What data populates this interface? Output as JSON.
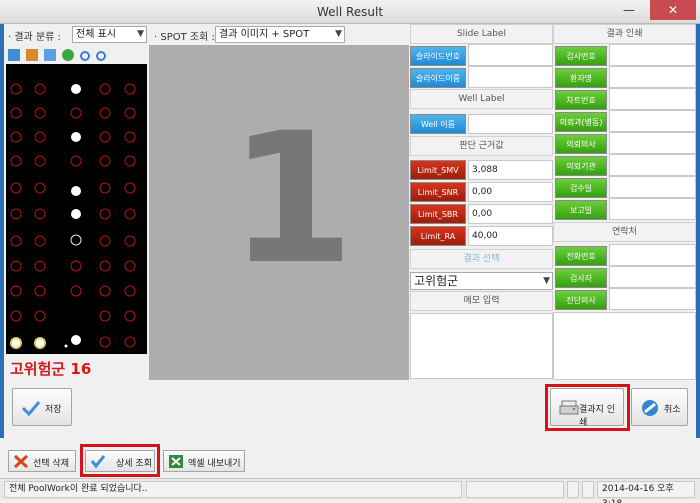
{
  "window": {
    "title": "Well Result",
    "minimize": "—",
    "close": "✕"
  },
  "filters": {
    "result_class_label": "· 결과 분류 :",
    "result_class_value": "전체 표시",
    "spot_label": "· SPOT 조회 :",
    "spot_value": "결과 이미지 + SPOT"
  },
  "view": {
    "well_number": "1",
    "result_name": "고위험군 16"
  },
  "slide_label": {
    "header": "Slide Label",
    "items": [
      {
        "label": "슬라이드번호",
        "value": ""
      },
      {
        "label": "슬라이드이름",
        "value": ""
      }
    ]
  },
  "well_label": {
    "header": "Well Label",
    "items": [
      {
        "label": "Well 이름",
        "value": ""
      }
    ]
  },
  "judge": {
    "header": "판단 근거값",
    "items": [
      {
        "label": "Limit_SMV",
        "value": "3,088"
      },
      {
        "label": "Limit_SNR",
        "value": "0,00"
      },
      {
        "label": "Limit_SBR",
        "value": "0,00"
      },
      {
        "label": "Limit_RA",
        "value": "40,00"
      }
    ]
  },
  "result_select": {
    "header": "결과 선택",
    "value": "고위험군"
  },
  "memo": {
    "header": "메모 입력",
    "value": ""
  },
  "print_info": {
    "header": "결과 인쇄",
    "items": [
      {
        "label": "검사번호",
        "value": ""
      },
      {
        "label": "환자명",
        "value": ""
      },
      {
        "label": "차트번호",
        "value": ""
      },
      {
        "label": "의뢰과(병동)",
        "value": ""
      },
      {
        "label": "의뢰의사",
        "value": ""
      },
      {
        "label": "의뢰기관",
        "value": ""
      },
      {
        "label": "검수일",
        "value": ""
      },
      {
        "label": "보고일",
        "value": ""
      }
    ]
  },
  "contact": {
    "header": "연락처",
    "items": [
      {
        "label": "전화번호",
        "value": ""
      },
      {
        "label": "검사자",
        "value": ""
      },
      {
        "label": "진단의사",
        "value": ""
      }
    ]
  },
  "buttons": {
    "save": "저장",
    "print_report": "결과지 인쇄",
    "cancel": "취소"
  },
  "toolbar": {
    "delete_selected": "선택 삭제",
    "detail_view": "상세 조회",
    "export_excel": "엑셀 내보내기"
  },
  "status": {
    "message": "전체 PoolWork이 완료 되었습니다..",
    "datetime": "2014-04-16 오후 3:18"
  }
}
